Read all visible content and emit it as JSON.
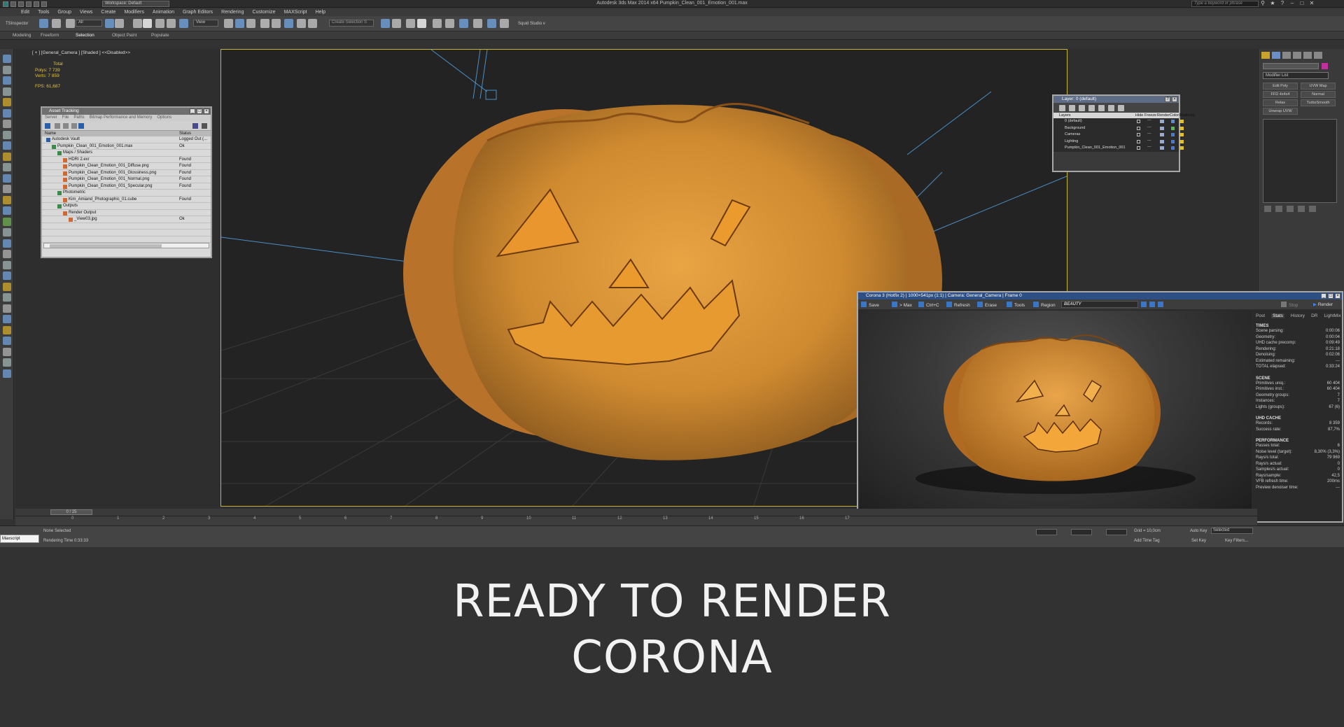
{
  "window": {
    "title": "Autodesk 3ds Max  2014 x64     Pumpkin_Clean_001_Emotion_001.max",
    "workspace": "Workspace: Default",
    "search_placeholder": "Type a keyword or phrase"
  },
  "menu": [
    "Edit",
    "Tools",
    "Group",
    "Views",
    "Create",
    "Modifiers",
    "Animation",
    "Graph Editors",
    "Rendering",
    "Customize",
    "MAXScript",
    "Help"
  ],
  "toolbar": {
    "selection_filter": "All",
    "named_selection": "Create Selection S",
    "view_dropdown": "View",
    "label_left": "TSInspector",
    "label_right": "Squid Studio v"
  },
  "ribbon_tabs": [
    "Modeling",
    "Freeform",
    "Selection",
    "Object Paint",
    "Populate"
  ],
  "viewport": {
    "label": "[ + ] [General_Camera ] [Shaded ] <<Disabled>>",
    "stats": {
      "total": "Total",
      "polys": "Polys:  7 739",
      "verts": "Verts:  7 859",
      "fps": "FPS:    61,687"
    }
  },
  "asset_tracking": {
    "title": "Asset Tracking",
    "menu": [
      "Server",
      "File",
      "Paths",
      "Bitmap Performance and Memory",
      "Options"
    ],
    "col_name": "Name",
    "col_status": "Status",
    "rows": [
      {
        "name": "Autodesk Vault",
        "status": "Logged Out (...",
        "indent": 0
      },
      {
        "name": "Pumpkin_Clean_001_Emotion_001.max",
        "status": "Ok",
        "indent": 1
      },
      {
        "name": "Maps / Shaders",
        "status": "",
        "indent": 2
      },
      {
        "name": "HDRI 2.exr",
        "status": "Found",
        "indent": 3
      },
      {
        "name": "Pumpkin_Clean_Emotion_001_Diffuse.png",
        "status": "Found",
        "indent": 3
      },
      {
        "name": "Pumpkin_Clean_Emotion_001_Glossiness.png",
        "status": "Found",
        "indent": 3
      },
      {
        "name": "Pumpkin_Clean_Emotion_001_Normal.png",
        "status": "Found",
        "indent": 3
      },
      {
        "name": "Pumpkin_Clean_Emotion_001_Specular.png",
        "status": "Found",
        "indent": 3
      },
      {
        "name": "Photometric",
        "status": "",
        "indent": 2
      },
      {
        "name": "Kim_Amiand_Photographic_01.cube",
        "status": "Found",
        "indent": 3
      },
      {
        "name": "Outputs",
        "status": "",
        "indent": 2
      },
      {
        "name": "Render Output",
        "status": "",
        "indent": 3
      },
      {
        "name": "_View03.jpg",
        "status": "Ok",
        "indent": 4
      }
    ]
  },
  "layers": {
    "title": "Layer: 0 (default)",
    "cols": [
      "Layers",
      "Hide",
      "Freeze",
      "Render",
      "Color",
      "Radiosity"
    ],
    "rows": [
      "0 (default)",
      "Background",
      "Cameras",
      "Lighting",
      "Pumpkin_Clean_001_Emotion_001"
    ]
  },
  "corona": {
    "title": "Corona 3 (Hotfix 2) | 1000×541px (1:1) | Camera: General_Camera | Frame 0",
    "buttons": [
      "Save",
      "> Max",
      "Ctrl+C",
      "Refresh",
      "Erase",
      "Tools",
      "Region"
    ],
    "pass": "BEAUTY",
    "stop": "Stop",
    "render": "Render",
    "tabs": [
      "Post",
      "Stats",
      "History",
      "DR",
      "LightMix"
    ],
    "sections": [
      {
        "title": "TIMES",
        "rows": [
          [
            "Scene parsing:",
            "0:00:06"
          ],
          [
            "Geometry:",
            "0:00:04"
          ],
          [
            "UHD cache precomp:",
            "0:09:49"
          ],
          [
            "Rendering:",
            "0:21:18"
          ],
          [
            "Denoising:",
            "0:02:06"
          ],
          [
            "Estimated remaining:",
            "---"
          ],
          [
            "TOTAL elapsed:",
            "0:33:24"
          ]
        ]
      },
      {
        "title": "SCENE",
        "rows": [
          [
            "Primitives uniq.:",
            "60 404"
          ],
          [
            "Primitives inst.:",
            "60 404"
          ],
          [
            "Geometry groups:",
            "7"
          ],
          [
            "Instances:",
            "7"
          ],
          [
            "Lights (groups):",
            "67 (6)"
          ]
        ]
      },
      {
        "title": "UHD CACHE",
        "rows": [
          [
            "Records:",
            "8 359"
          ],
          [
            "Success rate:",
            "87,7%"
          ]
        ]
      },
      {
        "title": "PERFORMANCE",
        "rows": [
          [
            "Passes total:",
            "6"
          ],
          [
            "Noise level (target):",
            "8,30% (3,3%)"
          ],
          [
            "Rays/s total:",
            "79 969"
          ],
          [
            "Rays/s actual:",
            "0"
          ],
          [
            "Samples/s actual:",
            "0"
          ],
          [
            "Rays/sample:",
            "42,5"
          ],
          [
            "VFB refresh time:",
            "200ms"
          ],
          [
            "Preview denoiser time:",
            "---"
          ]
        ]
      }
    ]
  },
  "right_panel": {
    "modifier_list": "Modifier List",
    "buttons": [
      "Edit Poly",
      "UVW Map",
      "FFD 4x4x4",
      "Normal",
      "Relax",
      "TurboSmooth",
      "Unwrap UVW"
    ]
  },
  "timeline": {
    "frame": "0 / 25",
    "ticks": [
      "0",
      "1",
      "2",
      "3",
      "4",
      "5",
      "6",
      "7",
      "8",
      "9",
      "10",
      "11",
      "12",
      "13",
      "14",
      "15",
      "16",
      "17"
    ]
  },
  "status": {
    "maxscript": "Maxscript",
    "selection": "None Selected",
    "render_time": "Rendering Time  0:33:33",
    "grid": "Grid = 10,0cm",
    "auto_key": "Auto Key",
    "auto_key_value": "Selected",
    "set_key": "Set Key",
    "key_filters": "Key Filters...",
    "add_time_tag": "Add Time Tag"
  },
  "caption": {
    "line1": "READY TO RENDER",
    "line2": "CORONA"
  },
  "colors": {
    "viewport_border": "#c7b530",
    "stats_yellow": "#e3c33c",
    "corona_title": "#2d4f83",
    "pumpkin": "#d98b2a"
  }
}
